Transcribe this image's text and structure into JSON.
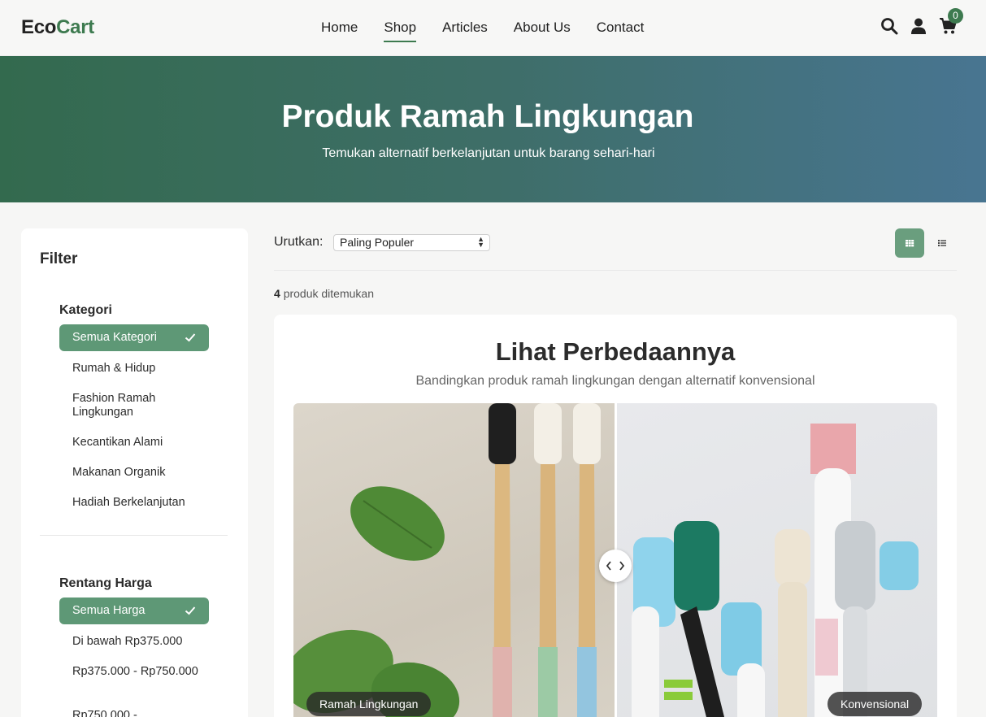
{
  "nav": {
    "logo_a": "Eco",
    "logo_b": "Cart",
    "links": [
      "Home",
      "Shop",
      "Articles",
      "About Us",
      "Contact"
    ],
    "active": "Shop",
    "cart_count": "0",
    "brand_color": "#3d7a4f"
  },
  "hero": {
    "title": "Produk Ramah Lingkungan",
    "subtitle": "Temukan alternatif berkelanjutan untuk barang sehari-hari"
  },
  "filter": {
    "title": "Filter",
    "category_heading": "Kategori",
    "categories": [
      "Semua Kategori",
      "Rumah & Hidup",
      "Fashion Ramah Lingkungan",
      "Kecantikan Alami",
      "Makanan Organik",
      "Hadiah Berkelanjutan"
    ],
    "price_heading": "Rentang Harga",
    "prices": [
      "Semua Harga",
      "Di bawah Rp375.000",
      "Rp375.000 - Rp750.000",
      "Rp750.000 -"
    ]
  },
  "toolbar": {
    "sort_label": "Urutkan:",
    "sort_value": "Paling Populer",
    "count_num": "4",
    "count_text": "produk ditemukan"
  },
  "compare": {
    "title": "Lihat Perbedaannya",
    "subtitle": "Bandingkan produk ramah lingkungan dengan alternatif konvensional",
    "left_label": "Ramah Lingkungan",
    "right_label": "Konvensional"
  }
}
